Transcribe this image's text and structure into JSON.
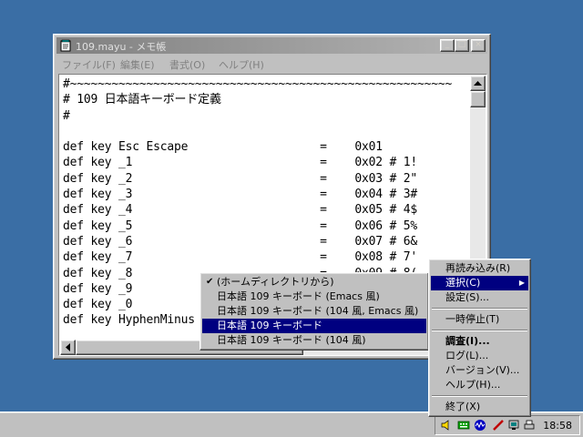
{
  "window": {
    "title": "109.mayu - メモ帳",
    "buttons": {
      "minimize": "_",
      "maximize": "□",
      "close": "×"
    },
    "menu": [
      "ファイル(F)",
      "編集(E)",
      "書式(O)",
      "ヘルプ(H)"
    ],
    "content": "#~~~~~~~~~~~~~~~~~~~~~~~~~~~~~~~~~~~~~~~~~~~~~~~~~~~~~~~\n# 109 日本語キーボード定義\n#\n\ndef key Esc Escape                   =    0x01\ndef key _1                           =    0x02 # 1!\ndef key _2                           =    0x03 # 2\"\ndef key _3                           =    0x04 # 3#\ndef key _4                           =    0x05 # 4$\ndef key _5                           =    0x06 # 5%\ndef key _6                           =    0x07 # 6&\ndef key _7                           =    0x08 # 7'\ndef key _8                           =    0x09 # 8(\ndef key _9                           =    0x0a # 9)\ndef key _0                           =    0x0b # 0\ndef key HyphenMinus                  =    0x0c # -="
  },
  "tray_menu": {
    "items": [
      {
        "label": "再読み込み(R)",
        "type": "item"
      },
      {
        "label": "選択(C)",
        "type": "submenu",
        "selected": true
      },
      {
        "label": "設定(S)...",
        "type": "item"
      },
      {
        "type": "separator"
      },
      {
        "label": "一時停止(T)",
        "type": "item"
      },
      {
        "type": "separator"
      },
      {
        "label": "調査(I)...",
        "type": "item",
        "bold": true
      },
      {
        "label": "ログ(L)...",
        "type": "item"
      },
      {
        "label": "バージョン(V)...",
        "type": "item"
      },
      {
        "label": "ヘルプ(H)...",
        "type": "item"
      },
      {
        "type": "separator"
      },
      {
        "label": "終了(X)",
        "type": "item"
      }
    ]
  },
  "select_submenu": {
    "items": [
      {
        "label": "(ホームディレクトリから)",
        "checked": true
      },
      {
        "label": "日本語 109 キーボード (Emacs 風)"
      },
      {
        "label": "日本語 109 キーボード (104 風, Emacs 風)"
      },
      {
        "label": "日本語 109 キーボード",
        "selected": true
      },
      {
        "label": "日本語 109 キーボード (104 風)"
      }
    ]
  },
  "taskbar": {
    "clock": "18:58"
  },
  "icons": {
    "title": "notepad-icon",
    "tray": [
      "speaker-icon",
      "keyboard-icon",
      "network-icon",
      "pen-icon",
      "monitor-icon",
      "printer-icon"
    ]
  },
  "colors": {
    "desktop": "#3a6ea5",
    "menu_highlight": "#000080",
    "inactive_title": "#808080"
  }
}
